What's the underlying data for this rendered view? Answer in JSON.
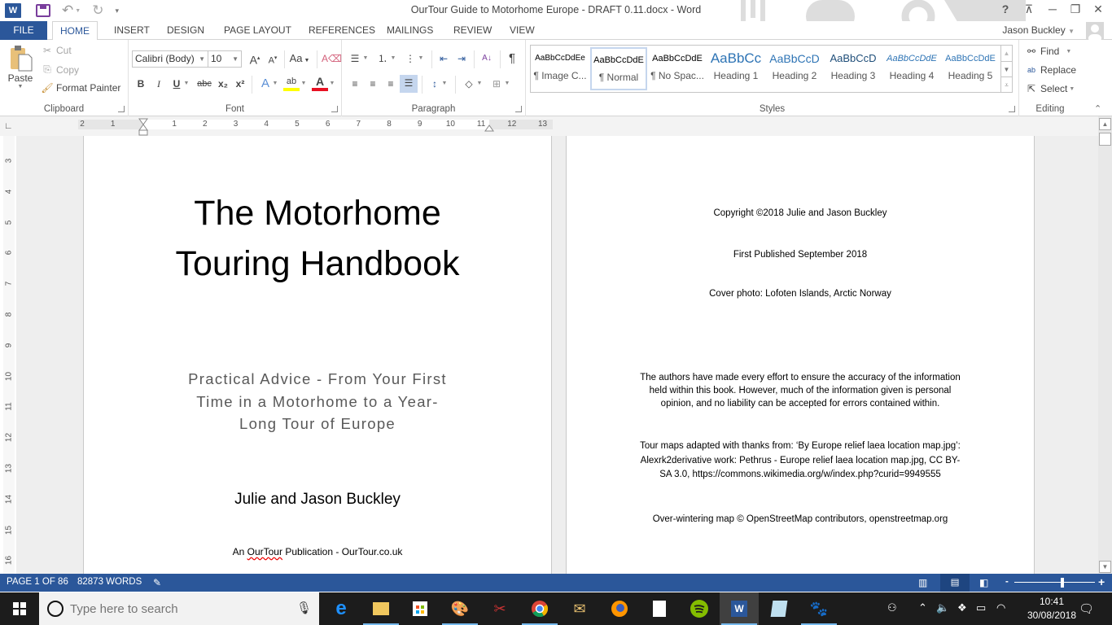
{
  "window": {
    "title": "OurTour Guide to Motorhome Europe - DRAFT 0.11.docx - Word",
    "user_name": "Jason Buckley",
    "help_label": "?",
    "app_icon_text": "W"
  },
  "tabs": [
    {
      "label": "FILE"
    },
    {
      "label": "HOME"
    },
    {
      "label": "INSERT"
    },
    {
      "label": "DESIGN"
    },
    {
      "label": "PAGE LAYOUT"
    },
    {
      "label": "REFERENCES"
    },
    {
      "label": "MAILINGS"
    },
    {
      "label": "REVIEW"
    },
    {
      "label": "VIEW"
    }
  ],
  "clipboard": {
    "group_label": "Clipboard",
    "paste": "Paste",
    "cut": "Cut",
    "copy": "Copy",
    "format_painter": "Format Painter"
  },
  "font": {
    "group_label": "Font",
    "font_name": "Calibri (Body)",
    "font_size": "10",
    "change_case": "Aa",
    "bold": "B",
    "italic": "I",
    "underline": "U",
    "strikethrough": "abc",
    "subscript": "x₂",
    "superscript": "x²",
    "highlight_color": "#ffff00",
    "font_color": "#e81123"
  },
  "paragraph": {
    "group_label": "Paragraph",
    "show_marks": "¶"
  },
  "styles": {
    "group_label": "Styles",
    "items": [
      {
        "preview": "AaBbCcDdEe",
        "name": "¶ Image C..."
      },
      {
        "preview": "AaBbCcDdE",
        "name": "¶ Normal",
        "selected": true
      },
      {
        "preview": "AaBbCcDdE",
        "name": "¶ No Spac..."
      },
      {
        "preview": "AaBbCc",
        "name": "Heading 1"
      },
      {
        "preview": "AaBbCcD",
        "name": "Heading 2"
      },
      {
        "preview": "AaBbCcD",
        "name": "Heading 3"
      },
      {
        "preview": "AaBbCcDdE",
        "name": "Heading 4"
      },
      {
        "preview": "AaBbCcDdE",
        "name": "Heading 5"
      }
    ]
  },
  "editing": {
    "group_label": "Editing",
    "find": "Find",
    "replace": "Replace",
    "select": "Select"
  },
  "ruler": {
    "h_labels": [
      "2",
      "1",
      "1",
      "2",
      "3",
      "4",
      "5",
      "6",
      "7",
      "8",
      "9",
      "10",
      "11",
      "12",
      "13"
    ],
    "v_labels": [
      "3",
      "4",
      "5",
      "6",
      "7",
      "8",
      "9",
      "10",
      "11",
      "12",
      "13",
      "14",
      "15",
      "16"
    ]
  },
  "page1": {
    "title_line1": "The Motorhome",
    "title_line2": "Touring Handbook",
    "subtitle_line1": "Practical Advice - From Your First",
    "subtitle_line2": "Time in a Motorhome to a Year-",
    "subtitle_line3": "Long Tour of Europe",
    "authors": "Julie and Jason Buckley",
    "publisher_prefix": "An ",
    "publisher_brand": "OurTour",
    "publisher_suffix": " Publication - OurTour.co.uk"
  },
  "page2": {
    "copyright": "Copyright ©2018 Julie and Jason Buckley",
    "first_published": "First Published September 2018",
    "cover_photo": "Cover photo: Lofoten Islands, Arctic Norway",
    "disclaimer_line1": "The authors have made every effort to ensure the accuracy of the information",
    "disclaimer_line2": "held within this book. However, much of the information given is personal",
    "disclaimer_line3": "opinion, and no liability can be accepted for errors contained within.",
    "maps_line1": "Tour maps adapted with thanks from: ‘By Europe relief laea location map.jpg’:",
    "maps_line2": "Alexrk2derivative work: Pethrus - Europe relief laea location map.jpg, CC BY-",
    "maps_line3": "SA 3.0, https://commons.wikimedia.org/w/index.php?curid=9949555",
    "osm_credit": "Over-wintering map © OpenStreetMap contributors, openstreetmap.org"
  },
  "status": {
    "page": "PAGE 1 OF 86",
    "words": "82873 WORDS",
    "zoom_minus": "-",
    "zoom_plus": "+",
    "zoom_slider_fraction": 0.6
  },
  "taskbar": {
    "search_placeholder": "Type here to search",
    "time": "10:41",
    "date": "30/08/2018",
    "apps": [
      {
        "name": "edge"
      },
      {
        "name": "file-explorer"
      },
      {
        "name": "store"
      },
      {
        "name": "paint"
      },
      {
        "name": "snipping-tool"
      },
      {
        "name": "chrome"
      },
      {
        "name": "mail-folder"
      },
      {
        "name": "firefox"
      },
      {
        "name": "calculator"
      },
      {
        "name": "spotify"
      },
      {
        "name": "word"
      },
      {
        "name": "notepad"
      },
      {
        "name": "gimp"
      }
    ]
  },
  "colors": {
    "accent": "#2b579a",
    "taskbar": "#1c1c1c"
  }
}
